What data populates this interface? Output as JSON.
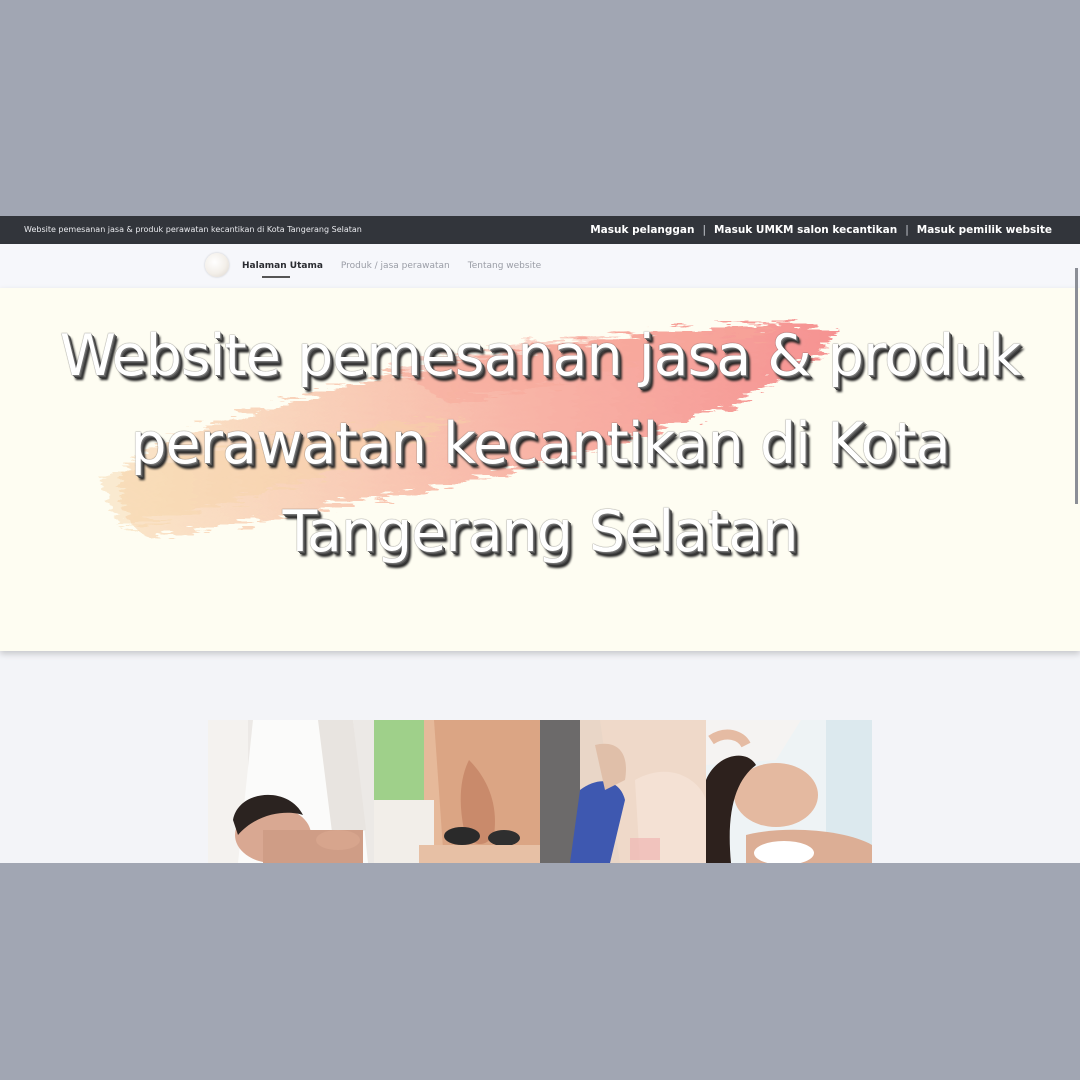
{
  "topbar": {
    "tagline": "Website pemesanan jasa & produk perawatan kecantikan di Kota Tangerang Selatan",
    "links": [
      {
        "label": "Masuk pelanggan"
      },
      {
        "label": "Masuk UMKM salon kecantikan"
      },
      {
        "label": "Masuk pemilik website"
      }
    ],
    "separator": "|"
  },
  "navbar": {
    "logo_icon": "salon-logo-icon",
    "items": [
      {
        "label": "Halaman Utama",
        "active": true
      },
      {
        "label": "Produk / jasa perawatan",
        "active": false
      },
      {
        "label": "Tentang website",
        "active": false
      }
    ]
  },
  "hero": {
    "title_lines": [
      "Website pemesanan jasa & produk",
      "perawatan kecantikan di Kota",
      "Tangerang Selatan"
    ],
    "brush_colors": [
      "#f6d2a7",
      "#f7a89a",
      "#f58c8c"
    ]
  },
  "photos": [
    {
      "name": "massage-photo"
    },
    {
      "name": "hot-stone-photo"
    },
    {
      "name": "body-treatment-photo"
    },
    {
      "name": "facial-photo"
    }
  ],
  "colors": {
    "topbar_bg": "#32353b",
    "hero_bg": "#fefdf2",
    "page_bg": "#f3f4f8"
  }
}
